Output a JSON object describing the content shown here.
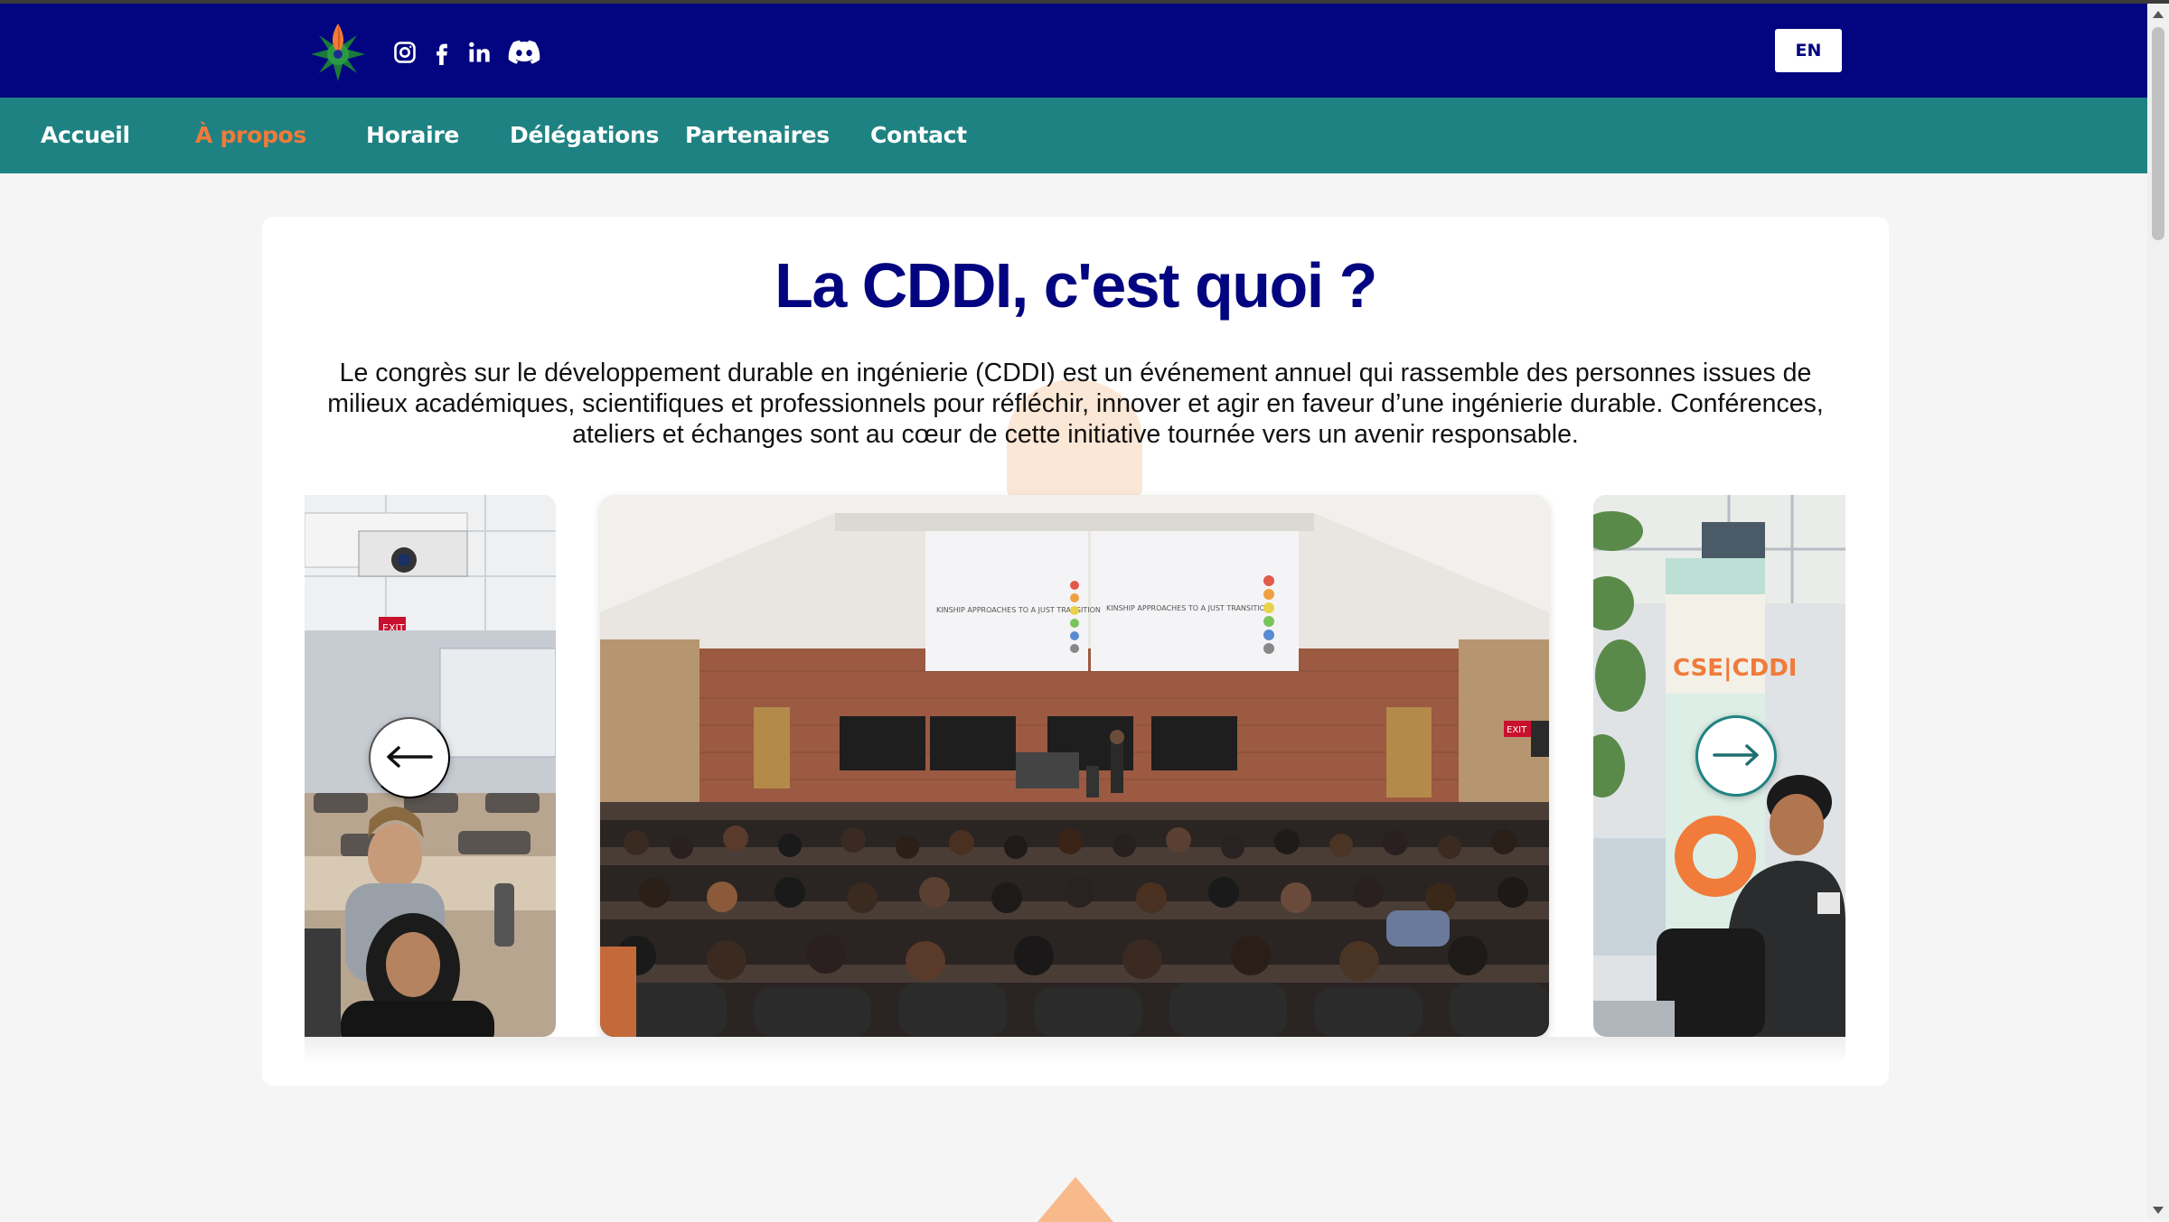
{
  "header": {
    "logo_icon": "cddi-logo-icon",
    "social_icons": [
      "instagram-icon",
      "facebook-icon",
      "linkedin-icon",
      "discord-icon"
    ],
    "language_button": "EN"
  },
  "nav": {
    "items": [
      "Accueil",
      "À propos",
      "Horaire",
      "Délégations",
      "Partenaires",
      "Contact"
    ],
    "active": "À propos"
  },
  "main": {
    "title": "La CDDI, c'est quoi ?",
    "description": "Le congrès sur le développement durable en ingénierie (CDDI) est un événement annuel qui rassemble des personnes issues de milieux académiques, scientifiques et professionnels pour réfléchir, innover et agir en faveur d’une ingénierie durable. Conférences, ateliers et échanges sont au cœur de cette initiative tournée vers un avenir responsable."
  },
  "carousel": {
    "center_slide": {
      "screen_text_left": "KINSHIP APPROACHES TO A JUST TRANSITION",
      "screen_text_right": "KINSHIP APPROACHES TO A JUST TRANSITION",
      "exit_sign": "EXIT"
    },
    "left_slide": {
      "exit_sign": "EXIT"
    },
    "right_slide": {
      "banner_text": "CSE|CDDI"
    },
    "prev_icon": "arrow-left-icon",
    "next_icon": "arrow-right-icon"
  },
  "colors": {
    "header_bg": "#02057f",
    "nav_bg": "#1f8282",
    "nav_active": "#f07b3a",
    "title": "#02057f",
    "accent_orange": "#f8b98b"
  }
}
